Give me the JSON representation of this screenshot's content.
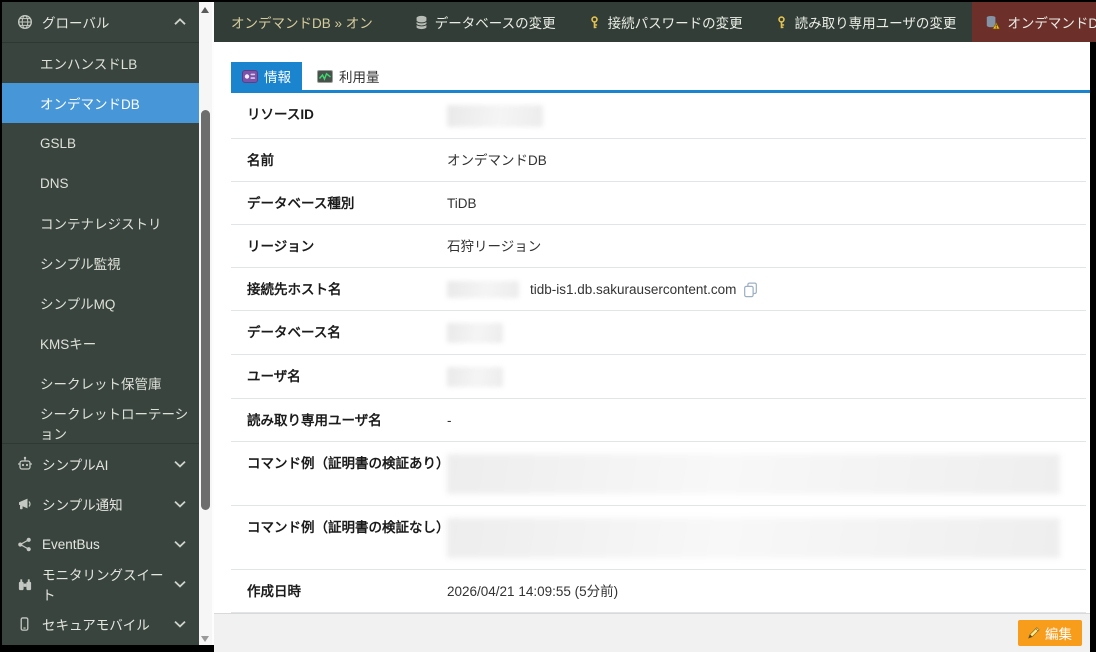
{
  "sidebar": {
    "items": [
      {
        "label": "グローバル",
        "icon": "globe",
        "expanded": true
      },
      {
        "label": "エンハンスドLB"
      },
      {
        "label": "オンデマンドDB",
        "selected": true
      },
      {
        "label": "GSLB"
      },
      {
        "label": "DNS"
      },
      {
        "label": "コンテナレジストリ"
      },
      {
        "label": "シンプル監視"
      },
      {
        "label": "シンプルMQ"
      },
      {
        "label": "KMSキー"
      },
      {
        "label": "シークレット保管庫"
      },
      {
        "label": "シークレットローテーション"
      },
      {
        "label": "シンプルAI",
        "icon": "robot",
        "collapsed": true
      },
      {
        "label": "シンプル通知",
        "icon": "megaphone",
        "collapsed": true
      },
      {
        "label": "EventBus",
        "icon": "share",
        "collapsed": true
      },
      {
        "label": "モニタリングスイート",
        "icon": "binoculars",
        "collapsed": true
      },
      {
        "label": "セキュアモバイル",
        "icon": "mobile",
        "collapsed": true
      }
    ]
  },
  "topbar": {
    "breadcrumb": "オンデマンドDB » オン",
    "actions": [
      {
        "label": "データベースの変更",
        "icon": "database-icon"
      },
      {
        "label": "接続パスワードの変更",
        "icon": "key-icon"
      },
      {
        "label": "読み取り専用ユーザの変更",
        "icon": "key-icon"
      },
      {
        "label": "オンデマンドDBを削除",
        "icon": "delete-database-icon",
        "danger": true
      }
    ]
  },
  "tabs": [
    {
      "label": "情報",
      "active": true
    },
    {
      "label": "利用量",
      "active": false
    }
  ],
  "detail": {
    "rows": [
      {
        "label": "リソースID",
        "value": "",
        "redacted": true
      },
      {
        "label": "名前",
        "value": "オンデマンドDB"
      },
      {
        "label": "データベース種別",
        "value": "TiDB"
      },
      {
        "label": "リージョン",
        "value": "石狩リージョン"
      },
      {
        "label": "接続先ホスト名",
        "value": "tidb-is1.db.sakurausercontent.com",
        "redacted_prefix": true,
        "copyable": true
      },
      {
        "label": "データベース名",
        "value": "",
        "redacted": true
      },
      {
        "label": "ユーザ名",
        "value": "",
        "redacted": true
      },
      {
        "label": "読み取り専用ユーザ名",
        "value": "-"
      },
      {
        "label": "コマンド例（証明書の検証あり）",
        "value": "",
        "redacted_block": true
      },
      {
        "label": "コマンド例（証明書の検証なし）",
        "value": "",
        "redacted_block": true
      },
      {
        "label": "作成日時",
        "value": "2026/04/21 14:09:55 (5分前)"
      }
    ]
  },
  "footer": {
    "edit_label": "編集"
  },
  "colors": {
    "sidebar_bg": "#3a443e",
    "topbar_bg": "#333d37",
    "selected_item_blue": "#4796d8",
    "active_tab_blue": "#1b84cf",
    "danger_red": "#6d2f2a",
    "breadcrumb_tan": "#d5cd9c",
    "key_gold": "#e3c14f",
    "edit_orange": "#f89c1c"
  }
}
